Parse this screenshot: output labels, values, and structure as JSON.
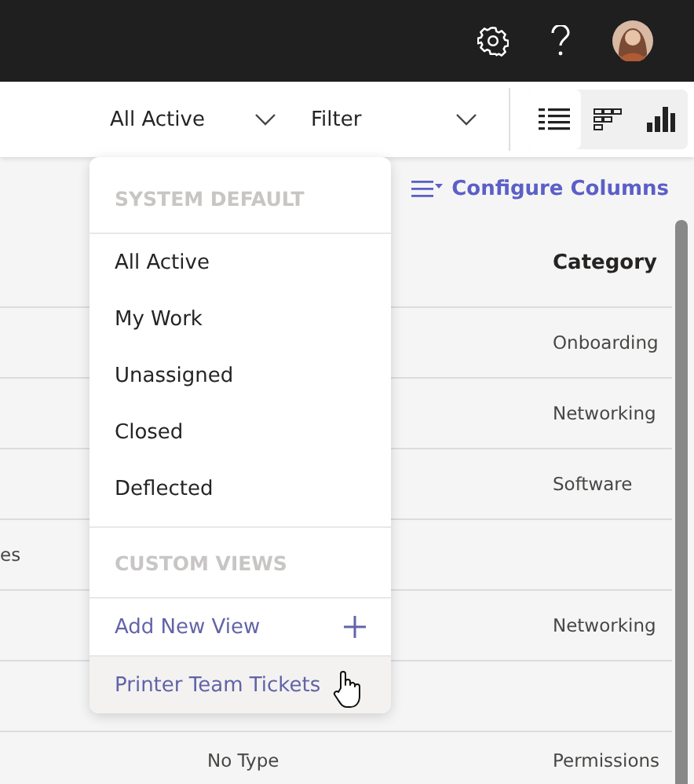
{
  "toolbar": {
    "view_dropdown": {
      "value": "All Active"
    },
    "filter_dropdown": {
      "value": "Filter"
    },
    "view_modes": [
      {
        "kind": "list",
        "selected": true
      },
      {
        "kind": "board",
        "selected": false
      },
      {
        "kind": "chart",
        "selected": false
      }
    ]
  },
  "configure_columns": "Configure Columns",
  "table": {
    "columns": [
      {
        "label": "Category"
      }
    ],
    "rows": [
      {
        "category": "Onboarding"
      },
      {
        "category": "Networking"
      },
      {
        "category": "Software"
      },
      {
        "column_1": "es"
      },
      {
        "category": "Networking"
      },
      {},
      {
        "column_2": "No Type",
        "category": "Permissions"
      }
    ]
  },
  "view_menu": {
    "sections": [
      {
        "title": "SYSTEM DEFAULT",
        "items": [
          {
            "label": "All Active",
            "kind": "view",
            "hovered": false
          },
          {
            "label": "My Work",
            "kind": "view",
            "hovered": false
          },
          {
            "label": "Unassigned",
            "kind": "view",
            "hovered": false
          },
          {
            "label": "Closed",
            "kind": "view",
            "hovered": false
          },
          {
            "label": "Deflected",
            "kind": "view",
            "hovered": false
          }
        ]
      },
      {
        "title": "CUSTOM VIEWS",
        "items": [
          {
            "label": "Add New View",
            "kind": "add",
            "hovered": false
          },
          {
            "label": "Printer Team Tickets",
            "kind": "custom",
            "hovered": true
          }
        ]
      }
    ]
  }
}
